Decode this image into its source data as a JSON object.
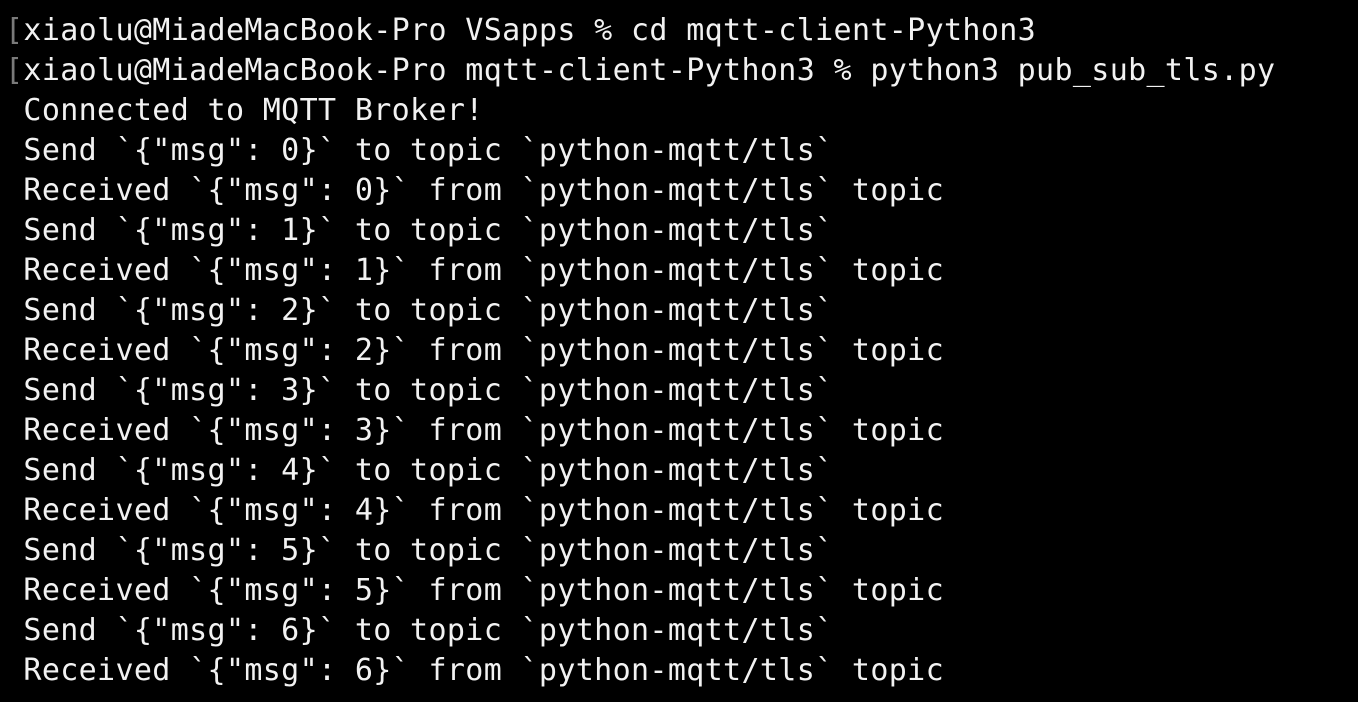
{
  "terminal": {
    "app": "terminal-emulator",
    "colors": {
      "background": "#000000",
      "foreground": "#f2f2f2",
      "prompt_bracket": "#7a7a7a"
    },
    "user": "xiaolu",
    "host": "MiadeMacBook-Pro",
    "prompt_symbol": "%",
    "cwd_initial": "VSapps",
    "cwd_after_cd": "mqtt-client-Python3",
    "commands": [
      "cd mqtt-client-Python3",
      "python3 pub_sub_tls.py"
    ],
    "topic": "python-mqtt/tls",
    "lines": [
      {
        "kind": "prompt",
        "bracket": "[",
        "text": "xiaolu@MiadeMacBook-Pro VSapps % cd mqtt-client-Python3"
      },
      {
        "kind": "prompt",
        "bracket": "[",
        "text": "xiaolu@MiadeMacBook-Pro mqtt-client-Python3 % python3 pub_sub_tls.py"
      },
      {
        "kind": "output",
        "text": " Connected to MQTT Broker!"
      },
      {
        "kind": "output",
        "text": " Send `{\"msg\": 0}` to topic `python-mqtt/tls`"
      },
      {
        "kind": "output",
        "text": " Received `{\"msg\": 0}` from `python-mqtt/tls` topic"
      },
      {
        "kind": "output",
        "text": " Send `{\"msg\": 1}` to topic `python-mqtt/tls`"
      },
      {
        "kind": "output",
        "text": " Received `{\"msg\": 1}` from `python-mqtt/tls` topic"
      },
      {
        "kind": "output",
        "text": " Send `{\"msg\": 2}` to topic `python-mqtt/tls`"
      },
      {
        "kind": "output",
        "text": " Received `{\"msg\": 2}` from `python-mqtt/tls` topic"
      },
      {
        "kind": "output",
        "text": " Send `{\"msg\": 3}` to topic `python-mqtt/tls`"
      },
      {
        "kind": "output",
        "text": " Received `{\"msg\": 3}` from `python-mqtt/tls` topic"
      },
      {
        "kind": "output",
        "text": " Send `{\"msg\": 4}` to topic `python-mqtt/tls`"
      },
      {
        "kind": "output",
        "text": " Received `{\"msg\": 4}` from `python-mqtt/tls` topic"
      },
      {
        "kind": "output",
        "text": " Send `{\"msg\": 5}` to topic `python-mqtt/tls`"
      },
      {
        "kind": "output",
        "text": " Received `{\"msg\": 5}` from `python-mqtt/tls` topic"
      },
      {
        "kind": "output",
        "text": " Send `{\"msg\": 6}` to topic `python-mqtt/tls`"
      },
      {
        "kind": "output",
        "text": " Received `{\"msg\": 6}` from `python-mqtt/tls` topic"
      }
    ]
  }
}
